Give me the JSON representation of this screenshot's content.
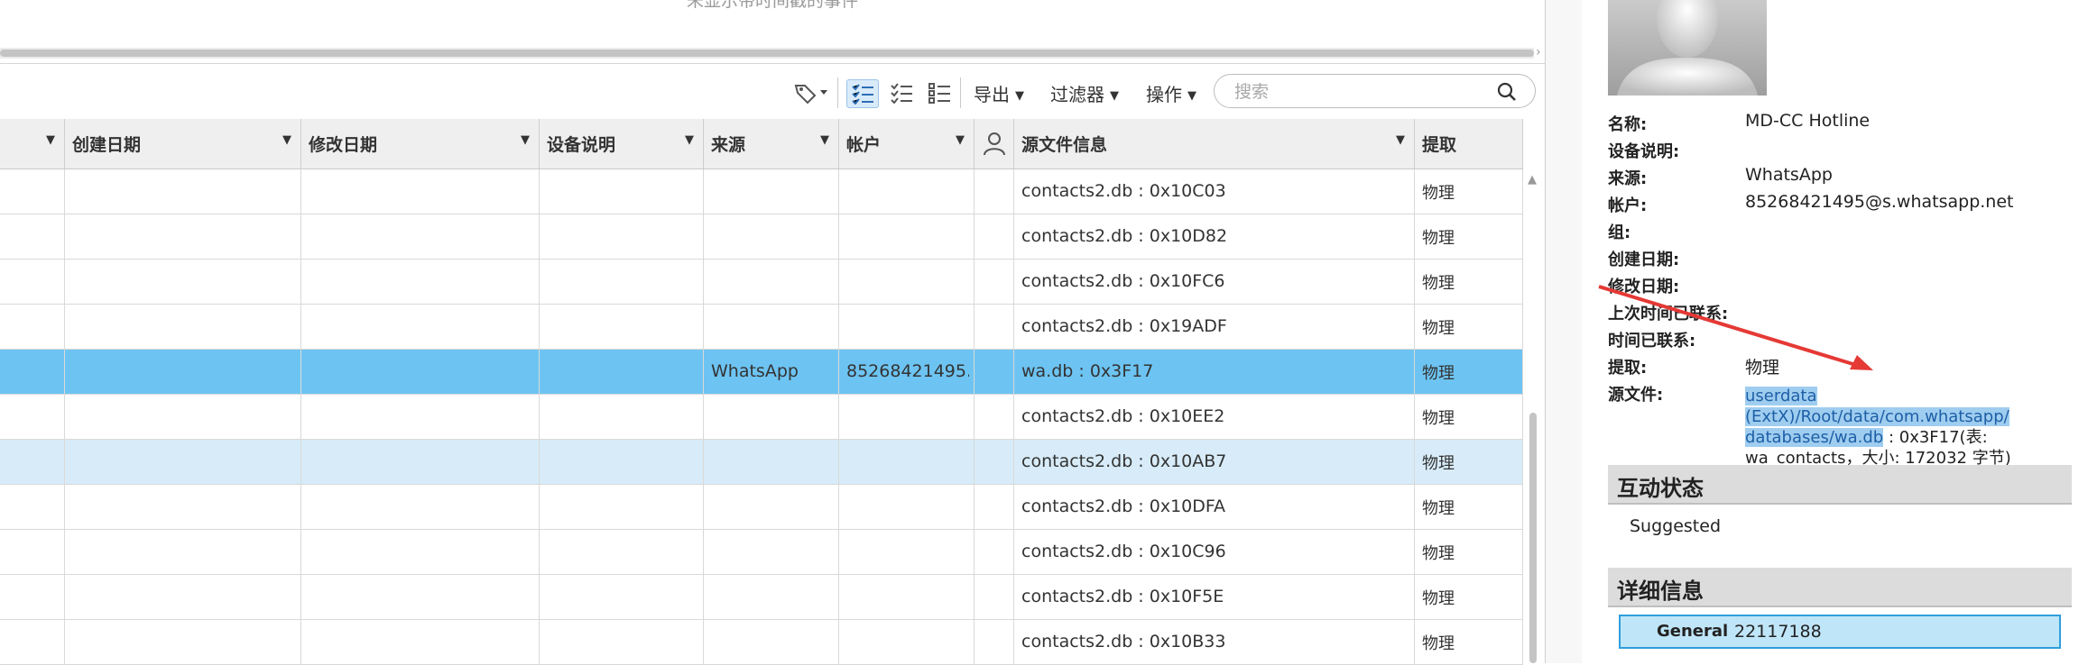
{
  "timeline": {
    "message": "未显示带时间戳的事件"
  },
  "toolbar": {
    "export": "导出",
    "filter": "过滤器",
    "actions": "操作",
    "search_placeholder": "搜索"
  },
  "grid": {
    "columns": [
      {
        "key": "prev",
        "label": ""
      },
      {
        "key": "created",
        "label": "创建日期"
      },
      {
        "key": "modified",
        "label": "修改日期"
      },
      {
        "key": "device",
        "label": "设备说明"
      },
      {
        "key": "source",
        "label": "来源"
      },
      {
        "key": "account",
        "label": "帐户"
      },
      {
        "key": "person",
        "label": ""
      },
      {
        "key": "srcfile",
        "label": "源文件信息"
      },
      {
        "key": "extraction",
        "label": "提取"
      }
    ],
    "rows": [
      {
        "source": "",
        "account": "",
        "srcfile": "contacts2.db : 0x10C03",
        "extraction": "物理"
      },
      {
        "source": "",
        "account": "",
        "srcfile": "contacts2.db : 0x10D82",
        "extraction": "物理"
      },
      {
        "source": "",
        "account": "",
        "srcfile": "contacts2.db : 0x10FC6",
        "extraction": "物理"
      },
      {
        "source": "",
        "account": "",
        "srcfile": "contacts2.db : 0x19ADF",
        "extraction": "物理"
      },
      {
        "source": "WhatsApp",
        "account": "85268421495...",
        "srcfile": "wa.db : 0x3F17",
        "extraction": "物理"
      },
      {
        "source": "",
        "account": "",
        "srcfile": "contacts2.db : 0x10EE2",
        "extraction": "物理"
      },
      {
        "source": "",
        "account": "",
        "srcfile": "contacts2.db : 0x10AB7",
        "extraction": "物理"
      },
      {
        "source": "",
        "account": "",
        "srcfile": "contacts2.db : 0x10DFA",
        "extraction": "物理"
      },
      {
        "source": "",
        "account": "",
        "srcfile": "contacts2.db : 0x10C96",
        "extraction": "物理"
      },
      {
        "source": "",
        "account": "",
        "srcfile": "contacts2.db : 0x10F5E",
        "extraction": "物理"
      },
      {
        "source": "",
        "account": "",
        "srcfile": "contacts2.db : 0x10B33",
        "extraction": "物理"
      }
    ]
  },
  "detail": {
    "props": [
      {
        "label": "名称:",
        "value": "MD-CC Hotline"
      },
      {
        "label": "设备说明:",
        "value": ""
      },
      {
        "label": "来源:",
        "value": "WhatsApp"
      },
      {
        "label": "帐户:",
        "value": "85268421495@s.whatsapp.net"
      },
      {
        "label": "组:",
        "value": ""
      },
      {
        "label": "创建日期:",
        "value": ""
      },
      {
        "label": "修改日期:",
        "value": ""
      },
      {
        "label": "上次时间已联系:",
        "value": ""
      },
      {
        "label": "时间已联系:",
        "value": ""
      },
      {
        "label": "提取:",
        "value": "物理"
      },
      {
        "label": "源文件:",
        "value": ""
      }
    ],
    "source_file": {
      "path_line1": "userdata (ExtX)/Root/data/com.whatsapp/",
      "path_line2": "databases/wa.db",
      "suffix": " : 0x3F17(表:",
      "line3": "wa_contacts，大小: 172032 字节)"
    },
    "interaction_title": "互动状态",
    "interaction_value": "Suggested",
    "details_title": "详细信息",
    "general_label": "General",
    "general_value": "22117188"
  },
  "colors": {
    "selected_row": "#6dc4f2",
    "hover_row": "#d7ecf8",
    "highlight": "#9fcdf0",
    "annotation_arrow": "#e53935"
  }
}
